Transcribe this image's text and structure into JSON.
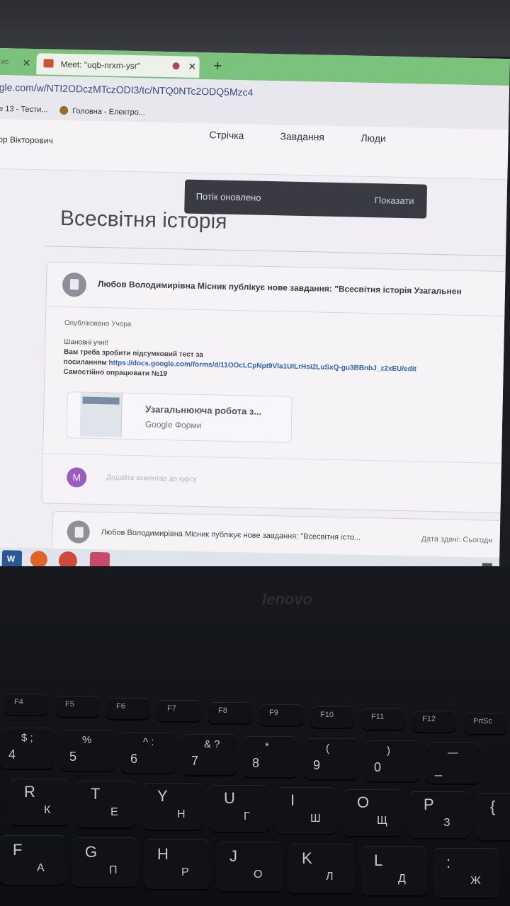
{
  "browser": {
    "left_tab_fragment": "ис",
    "active_tab_title": "Meet: \"uqb-nrxm-ysr\"",
    "new_tab_symbol": "+",
    "url": "gle.com/w/NTI2ODczMTczODI3/tc/NTQ0NTc2ODQ5Mzc4",
    "bookmark1": "е 13 - Тести...",
    "bookmark2": "Головна - Електро..."
  },
  "classroom": {
    "user_name": "ор Вікторович",
    "nav": {
      "stream": "Стрічка",
      "tasks": "Завдання",
      "people": "Люди"
    },
    "snackbar": {
      "message": "Потік оновлено",
      "action": "Показати"
    },
    "class_title": "Всесвітня історія",
    "post1": {
      "header": "Любов Володимирівна Місник публікує нове завдання: \"Всесвітня історія Узагальнен",
      "published": "Опубліковано Учора",
      "greeting": "Шановні учні!",
      "line1": "Вам треба зробити підсумковий тест за",
      "line2_prefix": "посиланням",
      "link": "https://docs.google.com/forms/d/11OOcLCpNpt9Vla1UILrHsi2LuSxQ-gu3BBnbJ_z2xEU/edit",
      "line3": "Самостійно опрацювати №19",
      "attachment_title": "Узагальнююча робота з...",
      "attachment_source": "Google Форми",
      "comment_avatar": "M",
      "comment_placeholder": "Додайте коментар до курсу"
    },
    "post2": {
      "header": "Любов Володимирівна Місник публікує нове завдання: \"Всесвітня істо...",
      "due": "Дата здачі: Сьогодн"
    }
  },
  "keyboard": {
    "brand": "lenovo",
    "fkeys": [
      "F4",
      "F5",
      "F6",
      "F7",
      "F8",
      "F9",
      "F10",
      "F11",
      "F12",
      "PrtSc"
    ],
    "number_row": [
      {
        "top": "$ ;",
        "main": "4"
      },
      {
        "top": "%",
        "main": "5"
      },
      {
        "top": "^ :",
        "main": "6"
      },
      {
        "top": "& ?",
        "main": "7"
      },
      {
        "top": "*",
        "main": "8"
      },
      {
        "top": "(",
        "main": "9"
      },
      {
        "top": ")",
        "main": "0"
      },
      {
        "top": "—",
        "main": "_"
      }
    ],
    "row_qwerty": [
      {
        "en": "R",
        "ua": "К"
      },
      {
        "en": "T",
        "ua": "Е"
      },
      {
        "en": "Y",
        "ua": "Н"
      },
      {
        "en": "U",
        "ua": "Г"
      },
      {
        "en": "I",
        "ua": "Ш"
      },
      {
        "en": "O",
        "ua": "Щ"
      },
      {
        "en": "P",
        "ua": "З"
      },
      {
        "en": "{",
        "ua": "["
      }
    ],
    "row_home": [
      {
        "en": "F",
        "ua": "А"
      },
      {
        "en": "G",
        "ua": "П"
      },
      {
        "en": "H",
        "ua": "Р"
      },
      {
        "en": "J",
        "ua": "О"
      },
      {
        "en": "K",
        "ua": "Л"
      },
      {
        "en": "L",
        "ua": "Д"
      },
      {
        "en": ":",
        "ua": "Ж"
      }
    ]
  }
}
